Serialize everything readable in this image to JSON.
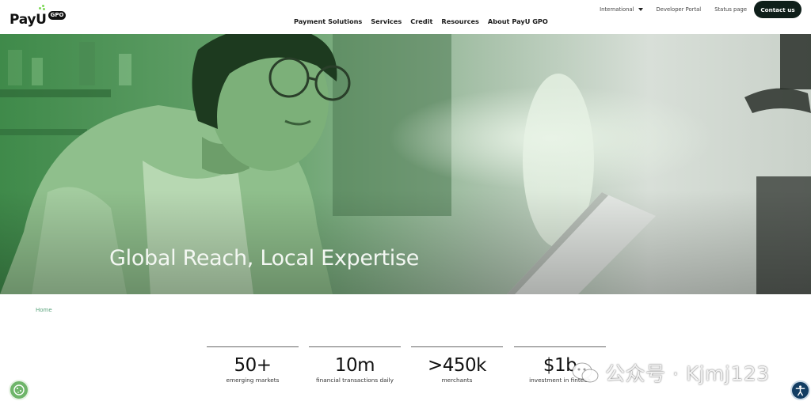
{
  "header": {
    "logo_text": "PayU",
    "logo_badge": "GPO",
    "nav": [
      "Payment Solutions",
      "Services",
      "Credit",
      "Resources",
      "About PayU GPO"
    ],
    "top_links": {
      "international": "International",
      "developer_portal": "Developer Portal",
      "status_page": "Status page"
    },
    "contact_label": "Contact us"
  },
  "hero": {
    "title": "Global Reach, Local Expertise"
  },
  "breadcrumb": {
    "home": "Home"
  },
  "stats": [
    {
      "value": "50+",
      "label": "emerging markets"
    },
    {
      "value": "10m",
      "label": "financial transactions daily"
    },
    {
      "value": ">450k",
      "label": "merchants"
    },
    {
      "value": "$1b",
      "label": "investment in fintech"
    }
  ],
  "watermark": {
    "text": "公众号 · Kjmj123"
  },
  "colors": {
    "hero_green": "#5fa86a",
    "contact_bg": "#0f1f1a",
    "breadcrumb": "#5aa37c",
    "cookie_icon_bg": "#6fb56a",
    "accessibility_bg": "#123d63"
  },
  "icons": {
    "cookie": "cookie-settings-icon",
    "accessibility": "accessibility-icon",
    "dropdown": "chevron-down-icon"
  }
}
